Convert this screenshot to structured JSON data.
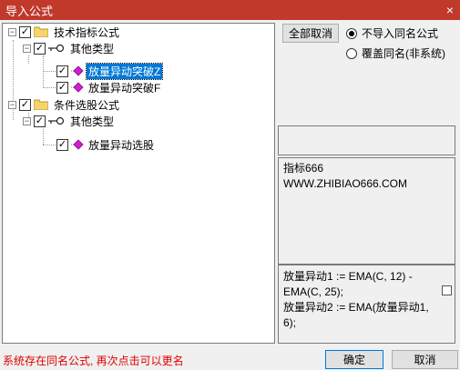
{
  "window": {
    "title": "导入公式",
    "close": "×"
  },
  "tree": [
    {
      "label": "技术指标公式"
    },
    {
      "label": "其他类型"
    },
    {
      "label": "放量异动突破Z"
    },
    {
      "label": "放量异动突破F"
    },
    {
      "label": "条件选股公式"
    },
    {
      "label": "其他类型"
    },
    {
      "label": "放量异动选股"
    }
  ],
  "options": {
    "deselect_all_label": "全部取消",
    "radio1_label": "不导入同名公式",
    "radio2_label": "覆盖同名(非系统)",
    "selected": "radio1"
  },
  "info": {
    "line1": "指标666",
    "line2": "WWW.ZHIBIAO666.COM"
  },
  "formula": {
    "line1": "放量异动1 := EMA(C, 12) -",
    "line2": "EMA(C, 25);",
    "line3": "放量异动2 := EMA(放量异动1,",
    "line4": "6);"
  },
  "footer": {
    "status": "系统存在同名公式, 再次点击可以更名",
    "ok_label": "确定",
    "cancel_label": "取消"
  }
}
